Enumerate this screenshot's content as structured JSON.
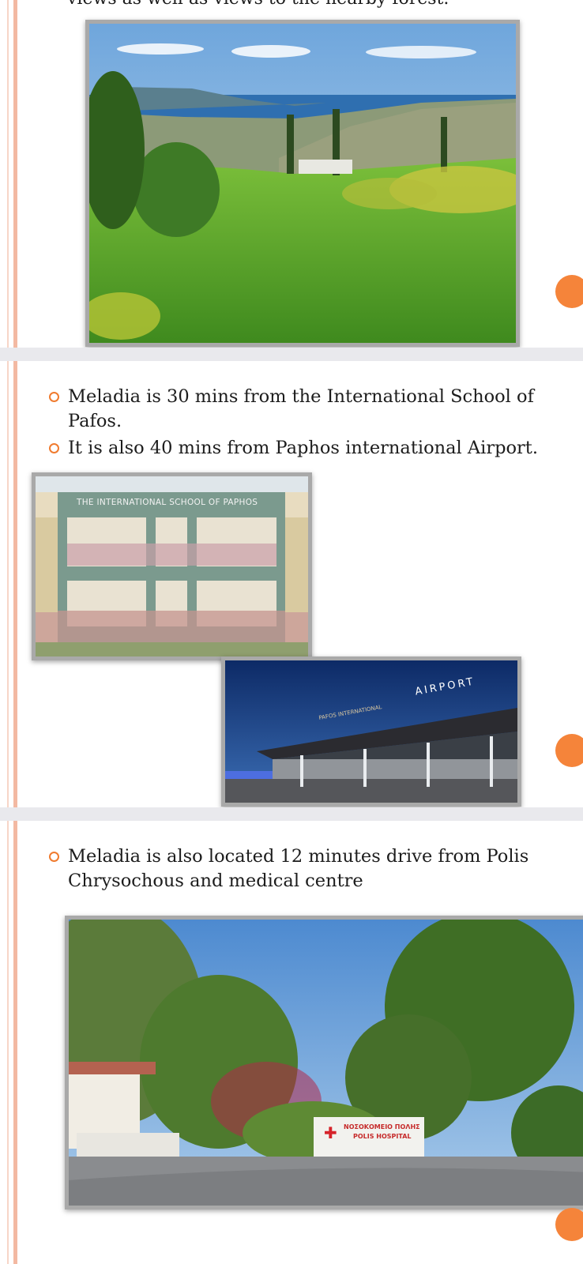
{
  "slide1": {
    "partial_text": "views as well as views to the nearby forest."
  },
  "slide2": {
    "bullets": [
      "Meladia is 30 mins from the International School of Pafos.",
      "It is also 40 mins from Paphos international Airport."
    ],
    "school_sign": "THE INTERNATIONAL SCHOOL OF PAPHOS",
    "airport_sign": "AIRPORT",
    "airport_sign_small": "PAFOS INTERNATIONAL"
  },
  "slide3": {
    "bullets": [
      "Meladia is also located 12 minutes drive from Polis Chrysochous and medical centre"
    ],
    "hospital_sign_line1": "ΝΟΣΟΚΟΜΕΙΟ ΠΟΛΗΣ",
    "hospital_sign_line2": "POLIS HOSPITAL"
  },
  "colors": {
    "accent": "#f5843a",
    "bullet": "#f07b2f",
    "rule": "#f3b9a2"
  }
}
